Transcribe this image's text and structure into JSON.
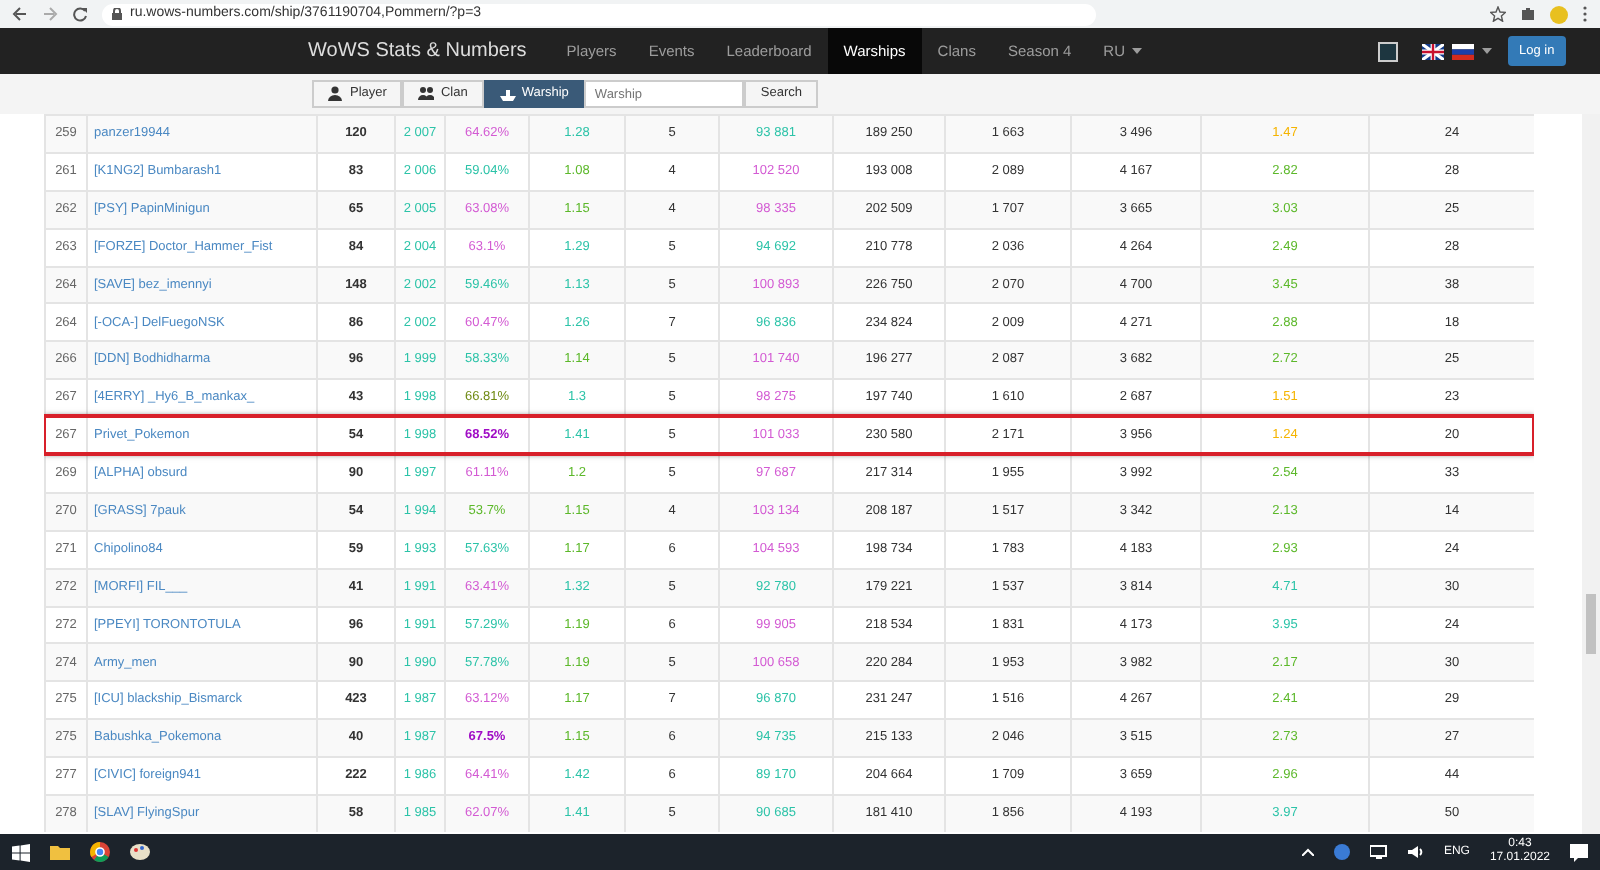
{
  "browser": {
    "url": "ru.wows-numbers.com/ship/3761190704,Pommern/?p=3"
  },
  "navbar": {
    "brand": "WoWS Stats & Numbers",
    "links": [
      {
        "label": "Players",
        "selected": false
      },
      {
        "label": "Events",
        "selected": false
      },
      {
        "label": "Leaderboard",
        "selected": false
      },
      {
        "label": "Warships",
        "selected": true
      },
      {
        "label": "Clans",
        "selected": false
      },
      {
        "label": "Season 4",
        "selected": false
      }
    ],
    "language": "RU",
    "login": "Log in"
  },
  "search": {
    "tabs": [
      {
        "label": "Player",
        "kind": "player",
        "selected": false
      },
      {
        "label": "Clan",
        "kind": "clan",
        "selected": false
      },
      {
        "label": "Warship",
        "kind": "warship",
        "selected": true
      }
    ],
    "placeholder": "Warship",
    "button": "Search"
  },
  "rows": [
    {
      "rank": "259",
      "player": "panzer19944",
      "highlighted": false,
      "cells": [
        {
          "text": "120"
        },
        {
          "text": "2 007",
          "color": "#2cc3a8"
        },
        {
          "text": "64.62%",
          "color": "#d35ad3"
        },
        {
          "text": "1.28",
          "color": "#2cc3a8"
        },
        {
          "text": "5"
        },
        {
          "text": "93 881",
          "color": "#2cc3a8"
        },
        {
          "text": "189 250"
        },
        {
          "text": "1 663"
        },
        {
          "text": "3 496"
        },
        {
          "text": "1.47",
          "color": "#f5b400"
        },
        {
          "text": "24"
        }
      ]
    },
    {
      "rank": "261",
      "player": "[K1NG2] Bumbarash1",
      "highlighted": false,
      "cells": [
        {
          "text": "83"
        },
        {
          "text": "2 006",
          "color": "#2cc3a8"
        },
        {
          "text": "59.04%",
          "color": "#2cc3a8"
        },
        {
          "text": "1.08",
          "color": "#5cb82a"
        },
        {
          "text": "4"
        },
        {
          "text": "102 520",
          "color": "#d35ad3"
        },
        {
          "text": "193 008"
        },
        {
          "text": "2 089"
        },
        {
          "text": "4 167"
        },
        {
          "text": "2.82",
          "color": "#5cb82a"
        },
        {
          "text": "28"
        }
      ]
    },
    {
      "rank": "262",
      "player": "[PSY] PapinMinigun",
      "highlighted": false,
      "cells": [
        {
          "text": "65"
        },
        {
          "text": "2 005",
          "color": "#2cc3a8"
        },
        {
          "text": "63.08%",
          "color": "#d35ad3"
        },
        {
          "text": "1.15",
          "color": "#5cb82a"
        },
        {
          "text": "4"
        },
        {
          "text": "98 335",
          "color": "#d35ad3"
        },
        {
          "text": "202 509"
        },
        {
          "text": "1 707"
        },
        {
          "text": "3 665"
        },
        {
          "text": "3.03",
          "color": "#5cb82a"
        },
        {
          "text": "25"
        }
      ]
    },
    {
      "rank": "263",
      "player": "[FORZE] Doctor_Hammer_Fist",
      "highlighted": false,
      "cells": [
        {
          "text": "84"
        },
        {
          "text": "2 004",
          "color": "#2cc3a8"
        },
        {
          "text": "63.1%",
          "color": "#d35ad3"
        },
        {
          "text": "1.29",
          "color": "#2cc3a8"
        },
        {
          "text": "5"
        },
        {
          "text": "94 692",
          "color": "#2cc3a8"
        },
        {
          "text": "210 778"
        },
        {
          "text": "2 036"
        },
        {
          "text": "4 264"
        },
        {
          "text": "2.49",
          "color": "#5cb82a"
        },
        {
          "text": "28"
        }
      ]
    },
    {
      "rank": "264",
      "player": "[SAVE] bez_imennyi",
      "highlighted": false,
      "cells": [
        {
          "text": "148"
        },
        {
          "text": "2 002",
          "color": "#2cc3a8"
        },
        {
          "text": "59.46%",
          "color": "#2cc3a8"
        },
        {
          "text": "1.13",
          "color": "#2cc3a8"
        },
        {
          "text": "5"
        },
        {
          "text": "100 893",
          "color": "#d35ad3"
        },
        {
          "text": "226 750"
        },
        {
          "text": "2 070"
        },
        {
          "text": "4 700"
        },
        {
          "text": "3.45",
          "color": "#5cb82a"
        },
        {
          "text": "38"
        }
      ]
    },
    {
      "rank": "264",
      "player": "[-OCA-] DelFuegoNSK",
      "highlighted": false,
      "cells": [
        {
          "text": "86"
        },
        {
          "text": "2 002",
          "color": "#2cc3a8"
        },
        {
          "text": "60.47%",
          "color": "#d35ad3"
        },
        {
          "text": "1.26",
          "color": "#2cc3a8"
        },
        {
          "text": "7"
        },
        {
          "text": "96 836",
          "color": "#2cc3a8"
        },
        {
          "text": "234 824"
        },
        {
          "text": "2 009"
        },
        {
          "text": "4 271"
        },
        {
          "text": "2.88",
          "color": "#5cb82a"
        },
        {
          "text": "18"
        }
      ]
    },
    {
      "rank": "266",
      "player": "[DDN] Bodhidharma",
      "highlighted": false,
      "cells": [
        {
          "text": "96"
        },
        {
          "text": "1 999",
          "color": "#2cc3a8"
        },
        {
          "text": "58.33%",
          "color": "#2cc3a8"
        },
        {
          "text": "1.14",
          "color": "#5cb82a"
        },
        {
          "text": "5"
        },
        {
          "text": "101 740",
          "color": "#d35ad3"
        },
        {
          "text": "196 277"
        },
        {
          "text": "2 087"
        },
        {
          "text": "3 682"
        },
        {
          "text": "2.72",
          "color": "#5cb82a"
        },
        {
          "text": "25"
        }
      ]
    },
    {
      "rank": "267",
      "player": "[4ERRY] _Hy6_B_mankax_",
      "highlighted": false,
      "cells": [
        {
          "text": "43"
        },
        {
          "text": "1 998",
          "color": "#2cc3a8"
        },
        {
          "text": "66.81%",
          "color": "#6f8a12"
        },
        {
          "text": "1.3",
          "color": "#2cc3a8"
        },
        {
          "text": "5"
        },
        {
          "text": "98 275",
          "color": "#d35ad3"
        },
        {
          "text": "197 740"
        },
        {
          "text": "1 610"
        },
        {
          "text": "2 687"
        },
        {
          "text": "1.51",
          "color": "#f5b400"
        },
        {
          "text": "23"
        }
      ]
    },
    {
      "rank": "267",
      "player": "Privet_Pokemon",
      "highlighted": true,
      "cells": [
        {
          "text": "54"
        },
        {
          "text": "1 998",
          "color": "#2cc3a8"
        },
        {
          "text": "68.52%",
          "color": "#a00dc5"
        },
        {
          "text": "1.41",
          "color": "#2cc3a8"
        },
        {
          "text": "5"
        },
        {
          "text": "101 033",
          "color": "#d35ad3"
        },
        {
          "text": "230 580"
        },
        {
          "text": "2 171"
        },
        {
          "text": "3 956"
        },
        {
          "text": "1.24",
          "color": "#f5b400"
        },
        {
          "text": "20"
        }
      ]
    },
    {
      "rank": "269",
      "player": "[ALPHA] obsurd",
      "highlighted": false,
      "cells": [
        {
          "text": "90"
        },
        {
          "text": "1 997",
          "color": "#2cc3a8"
        },
        {
          "text": "61.11%",
          "color": "#d35ad3"
        },
        {
          "text": "1.2",
          "color": "#5cb82a"
        },
        {
          "text": "5"
        },
        {
          "text": "97 687",
          "color": "#d35ad3"
        },
        {
          "text": "217 314"
        },
        {
          "text": "1 955"
        },
        {
          "text": "3 992"
        },
        {
          "text": "2.54",
          "color": "#5cb82a"
        },
        {
          "text": "33"
        }
      ]
    },
    {
      "rank": "270",
      "player": "[GRASS] 7pauk",
      "highlighted": false,
      "cells": [
        {
          "text": "54"
        },
        {
          "text": "1 994",
          "color": "#2cc3a8"
        },
        {
          "text": "53.7%",
          "color": "#5cb82a"
        },
        {
          "text": "1.15",
          "color": "#5cb82a"
        },
        {
          "text": "4"
        },
        {
          "text": "103 134",
          "color": "#d35ad3"
        },
        {
          "text": "208 187"
        },
        {
          "text": "1 517"
        },
        {
          "text": "3 342"
        },
        {
          "text": "2.13",
          "color": "#5cb82a"
        },
        {
          "text": "14"
        }
      ]
    },
    {
      "rank": "271",
      "player": "Chipolino84",
      "highlighted": false,
      "cells": [
        {
          "text": "59"
        },
        {
          "text": "1 993",
          "color": "#2cc3a8"
        },
        {
          "text": "57.63%",
          "color": "#2cc3a8"
        },
        {
          "text": "1.17",
          "color": "#5cb82a"
        },
        {
          "text": "6"
        },
        {
          "text": "104 593",
          "color": "#d35ad3"
        },
        {
          "text": "198 734"
        },
        {
          "text": "1 783"
        },
        {
          "text": "4 183"
        },
        {
          "text": "2.93",
          "color": "#5cb82a"
        },
        {
          "text": "24"
        }
      ]
    },
    {
      "rank": "272",
      "player": "[MORFI] FIL___",
      "highlighted": false,
      "cells": [
        {
          "text": "41"
        },
        {
          "text": "1 991",
          "color": "#2cc3a8"
        },
        {
          "text": "63.41%",
          "color": "#d35ad3"
        },
        {
          "text": "1.32",
          "color": "#2cc3a8"
        },
        {
          "text": "5"
        },
        {
          "text": "92 780",
          "color": "#2cc3a8"
        },
        {
          "text": "179 221"
        },
        {
          "text": "1 537"
        },
        {
          "text": "3 814"
        },
        {
          "text": "4.71",
          "color": "#2cc3a8"
        },
        {
          "text": "30"
        }
      ]
    },
    {
      "rank": "272",
      "player": "[PPEYI] TORONTOTULA",
      "highlighted": false,
      "cells": [
        {
          "text": "96"
        },
        {
          "text": "1 991",
          "color": "#2cc3a8"
        },
        {
          "text": "57.29%",
          "color": "#2cc3a8"
        },
        {
          "text": "1.19",
          "color": "#5cb82a"
        },
        {
          "text": "6"
        },
        {
          "text": "99 905",
          "color": "#d35ad3"
        },
        {
          "text": "218 534"
        },
        {
          "text": "1 831"
        },
        {
          "text": "4 173"
        },
        {
          "text": "3.95",
          "color": "#2cc3a8"
        },
        {
          "text": "24"
        }
      ]
    },
    {
      "rank": "274",
      "player": "Army_men",
      "highlighted": false,
      "cells": [
        {
          "text": "90"
        },
        {
          "text": "1 990",
          "color": "#2cc3a8"
        },
        {
          "text": "57.78%",
          "color": "#2cc3a8"
        },
        {
          "text": "1.19",
          "color": "#5cb82a"
        },
        {
          "text": "5"
        },
        {
          "text": "100 658",
          "color": "#d35ad3"
        },
        {
          "text": "220 284"
        },
        {
          "text": "1 953"
        },
        {
          "text": "3 982"
        },
        {
          "text": "2.17",
          "color": "#5cb82a"
        },
        {
          "text": "30"
        }
      ]
    },
    {
      "rank": "275",
      "player": "[ICU] blackship_Bismarck",
      "highlighted": false,
      "cells": [
        {
          "text": "423"
        },
        {
          "text": "1 987",
          "color": "#2cc3a8"
        },
        {
          "text": "63.12%",
          "color": "#d35ad3"
        },
        {
          "text": "1.17",
          "color": "#5cb82a"
        },
        {
          "text": "7"
        },
        {
          "text": "96 870",
          "color": "#2cc3a8"
        },
        {
          "text": "231 247"
        },
        {
          "text": "1 516"
        },
        {
          "text": "4 267"
        },
        {
          "text": "2.41",
          "color": "#5cb82a"
        },
        {
          "text": "29"
        }
      ]
    },
    {
      "rank": "275",
      "player": "Babushka_Pokemona",
      "highlighted": false,
      "cells": [
        {
          "text": "40"
        },
        {
          "text": "1 987",
          "color": "#2cc3a8"
        },
        {
          "text": "67.5%",
          "color": "#a00dc5"
        },
        {
          "text": "1.15",
          "color": "#5cb82a"
        },
        {
          "text": "6"
        },
        {
          "text": "94 735",
          "color": "#2cc3a8"
        },
        {
          "text": "215 133"
        },
        {
          "text": "2 046"
        },
        {
          "text": "3 515"
        },
        {
          "text": "2.73",
          "color": "#5cb82a"
        },
        {
          "text": "27"
        }
      ]
    },
    {
      "rank": "277",
      "player": "[CIVIC] foreign941",
      "highlighted": false,
      "cells": [
        {
          "text": "222"
        },
        {
          "text": "1 986",
          "color": "#2cc3a8"
        },
        {
          "text": "64.41%",
          "color": "#d35ad3"
        },
        {
          "text": "1.42",
          "color": "#2cc3a8"
        },
        {
          "text": "6"
        },
        {
          "text": "89 170",
          "color": "#2cc3a8"
        },
        {
          "text": "204 664"
        },
        {
          "text": "1 709"
        },
        {
          "text": "3 659"
        },
        {
          "text": "2.96",
          "color": "#5cb82a"
        },
        {
          "text": "44"
        }
      ]
    },
    {
      "rank": "278",
      "player": "[SLAV] FlyingSpur",
      "highlighted": false,
      "cells": [
        {
          "text": "58"
        },
        {
          "text": "1 985",
          "color": "#2cc3a8"
        },
        {
          "text": "62.07%",
          "color": "#d35ad3"
        },
        {
          "text": "1.41",
          "color": "#2cc3a8"
        },
        {
          "text": "5"
        },
        {
          "text": "90 685",
          "color": "#2cc3a8"
        },
        {
          "text": "181 410"
        },
        {
          "text": "1 856"
        },
        {
          "text": "4 193"
        },
        {
          "text": "3.97",
          "color": "#2cc3a8"
        },
        {
          "text": "50"
        }
      ]
    }
  ],
  "taskbar": {
    "language": "ENG",
    "time": "0:43",
    "date": "17.01.2022"
  }
}
